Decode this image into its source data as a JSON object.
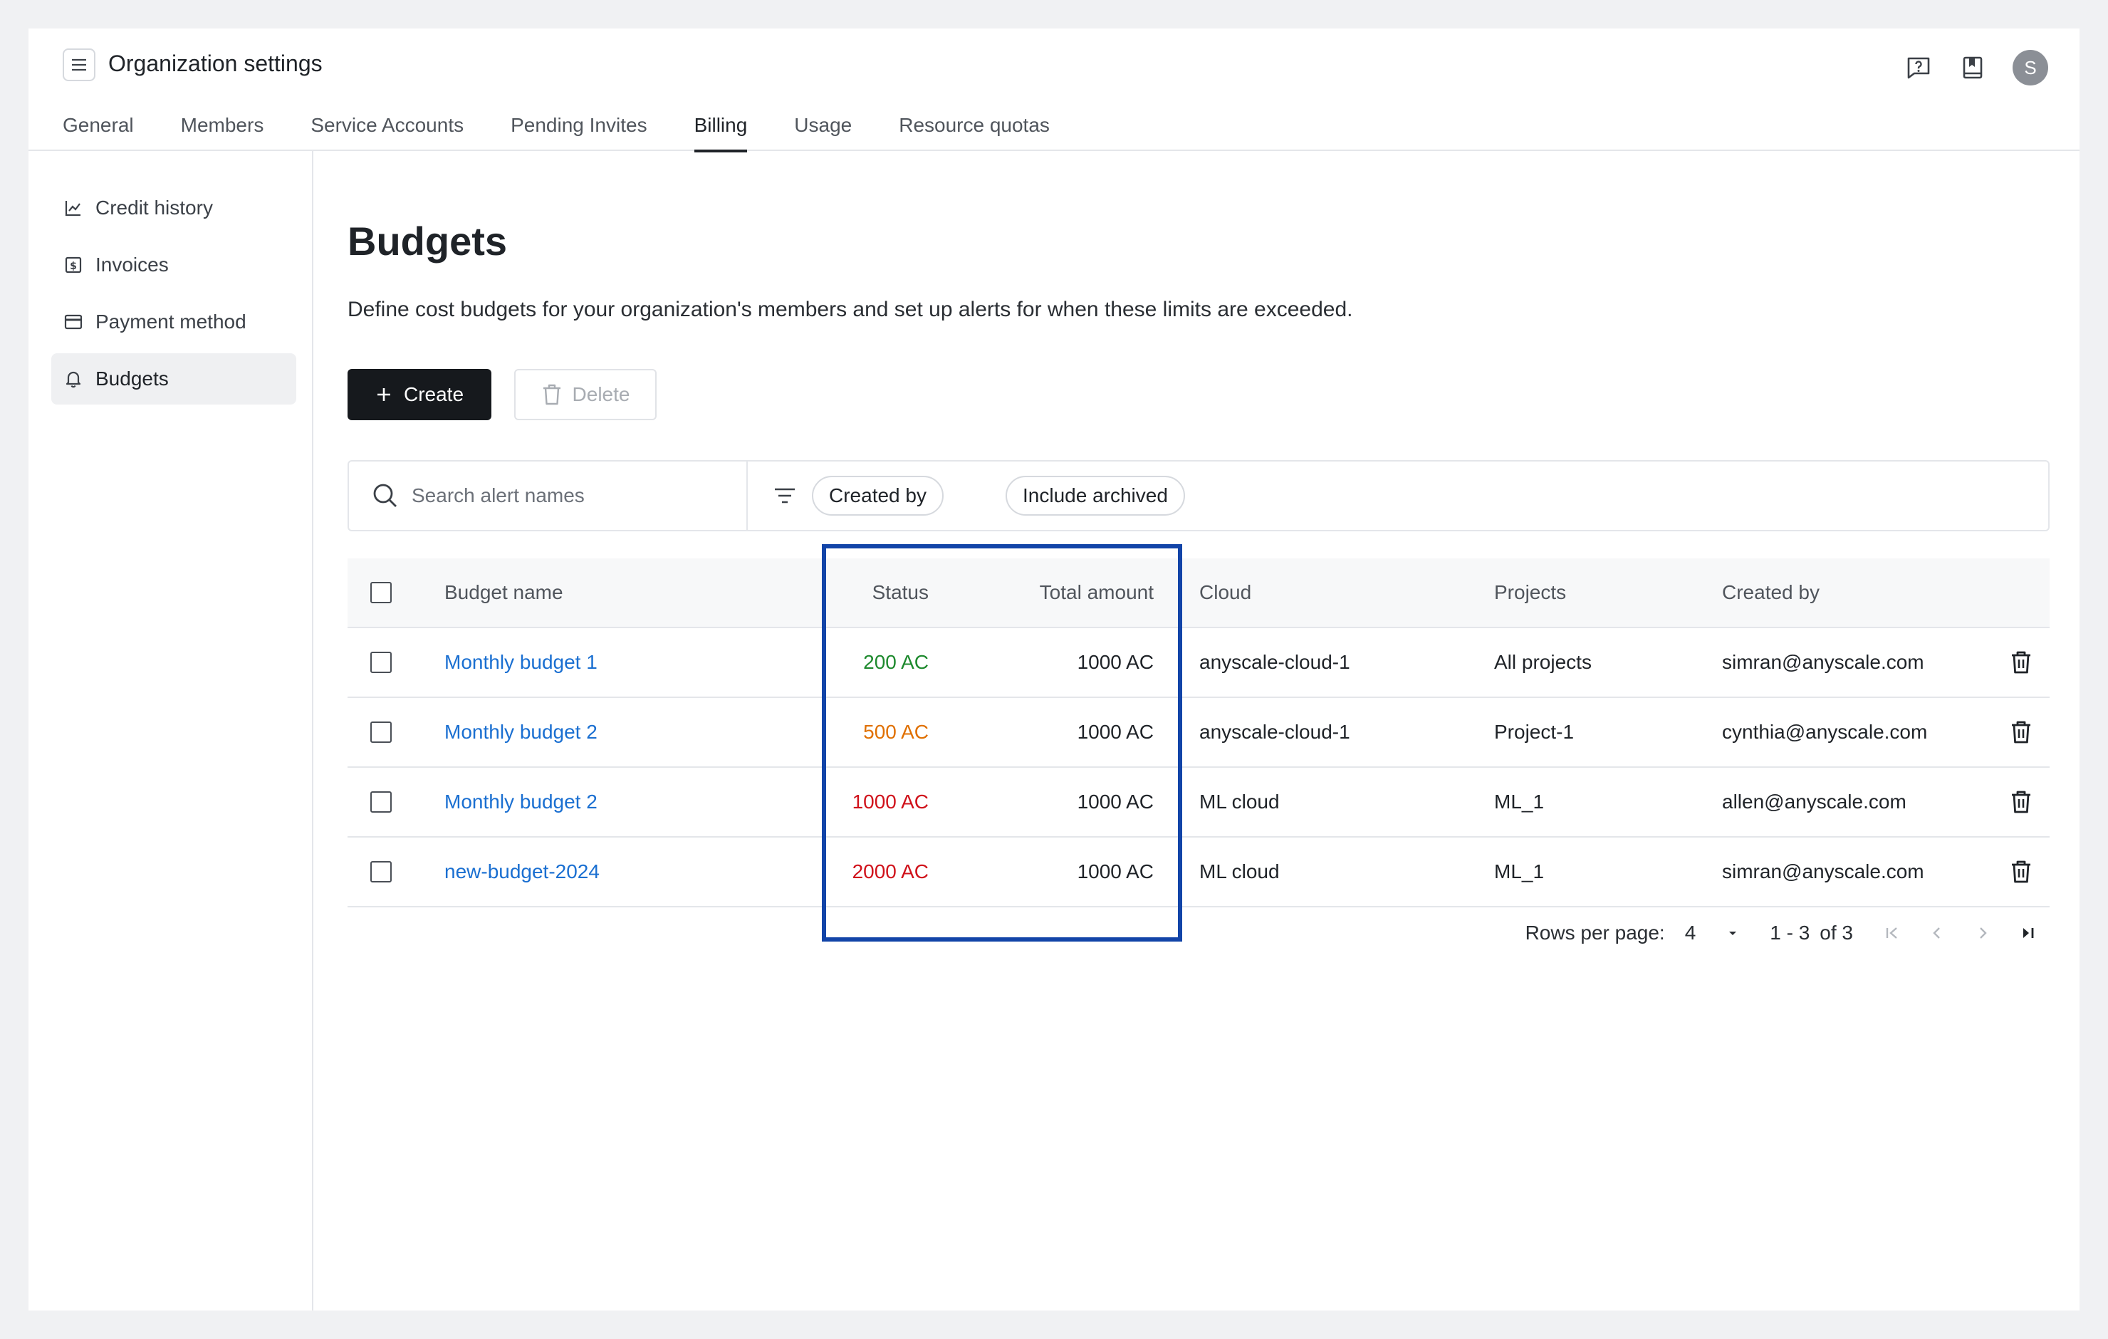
{
  "header": {
    "title": "Organization settings",
    "avatar_initial": "S"
  },
  "tabs": [
    {
      "label": "General"
    },
    {
      "label": "Members"
    },
    {
      "label": "Service Accounts"
    },
    {
      "label": "Pending Invites"
    },
    {
      "label": "Billing",
      "active": true
    },
    {
      "label": "Usage"
    },
    {
      "label": "Resource quotas"
    }
  ],
  "sidebar": {
    "items": [
      {
        "label": "Credit history",
        "icon": "chart-icon"
      },
      {
        "label": "Invoices",
        "icon": "invoice-icon"
      },
      {
        "label": "Payment method",
        "icon": "card-icon"
      },
      {
        "label": "Budgets",
        "icon": "bell-icon",
        "active": true
      }
    ]
  },
  "main": {
    "title": "Budgets",
    "description": "Define cost budgets for your organization's members and set up alerts for when these limits are exceeded.",
    "create_label": "Create",
    "delete_label": "Delete"
  },
  "filters": {
    "search_placeholder": "Search alert names",
    "chip_created_by": "Created by",
    "chip_include_archived": "Include archived"
  },
  "table": {
    "columns": [
      "Budget name",
      "Status",
      "Total amount",
      "Cloud",
      "Projects",
      "Created by"
    ],
    "rows": [
      {
        "name": "Monthly budget 1",
        "status": "200 AC",
        "status_color": "#1e8a2e",
        "total": "1000 AC",
        "cloud": "anyscale-cloud-1",
        "projects": "All projects",
        "created_by": "simran@anyscale.com"
      },
      {
        "name": "Monthly budget 2",
        "status": "500 AC",
        "status_color": "#e07000",
        "total": "1000 AC",
        "cloud": "anyscale-cloud-1",
        "projects": "Project-1",
        "created_by": "cynthia@anyscale.com"
      },
      {
        "name": "Monthly budget 2",
        "status": "1000 AC",
        "status_color": "#d0121b",
        "total": "1000 AC",
        "cloud": "ML cloud",
        "projects": "ML_1",
        "created_by": "allen@anyscale.com"
      },
      {
        "name": "new-budget-2024",
        "status": "2000 AC",
        "status_color": "#d0121b",
        "total": "1000 AC",
        "cloud": "ML cloud",
        "projects": "ML_1",
        "created_by": "simran@anyscale.com"
      }
    ]
  },
  "pagination": {
    "rows_per_page_label": "Rows per page:",
    "rows_per_page": "4",
    "range": "1 - 3",
    "of_total": "of 3"
  },
  "colors": {
    "highlight_border": "#1244a8",
    "link": "#1a6fd1",
    "primary_button": "#16191d"
  }
}
